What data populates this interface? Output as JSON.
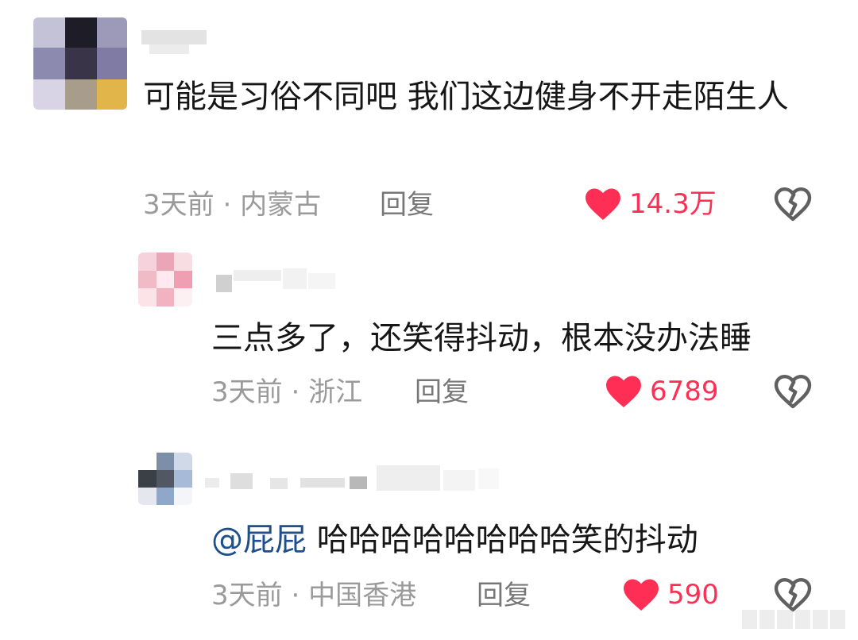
{
  "accent_color": "#ff2e55",
  "comments": [
    {
      "avatar_icon": "blurred-avatar",
      "text": "可能是习俗不同吧  我们这边健身不开走陌生人",
      "time": "3天前",
      "separator": "·",
      "location": "内蒙古",
      "reply_label": "回复",
      "like_count": "14.3万",
      "like_icon": "heart-icon",
      "dislike_icon": "broken-heart-icon"
    },
    {
      "avatar_icon": "blurred-avatar",
      "text": "三点多了，还笑得抖动，根本没办法睡",
      "time": "3天前",
      "separator": "·",
      "location": "浙江",
      "reply_label": "回复",
      "like_count": "6789",
      "like_icon": "heart-icon",
      "dislike_icon": "broken-heart-icon"
    },
    {
      "avatar_icon": "blurred-avatar",
      "mention": "@屁屁",
      "text": "哈哈哈哈哈哈哈哈笑的抖动",
      "time": "3天前",
      "separator": "·",
      "location": "中国香港",
      "reply_label": "回复",
      "like_count": "590",
      "like_icon": "heart-icon",
      "dislike_icon": "broken-heart-icon"
    }
  ]
}
